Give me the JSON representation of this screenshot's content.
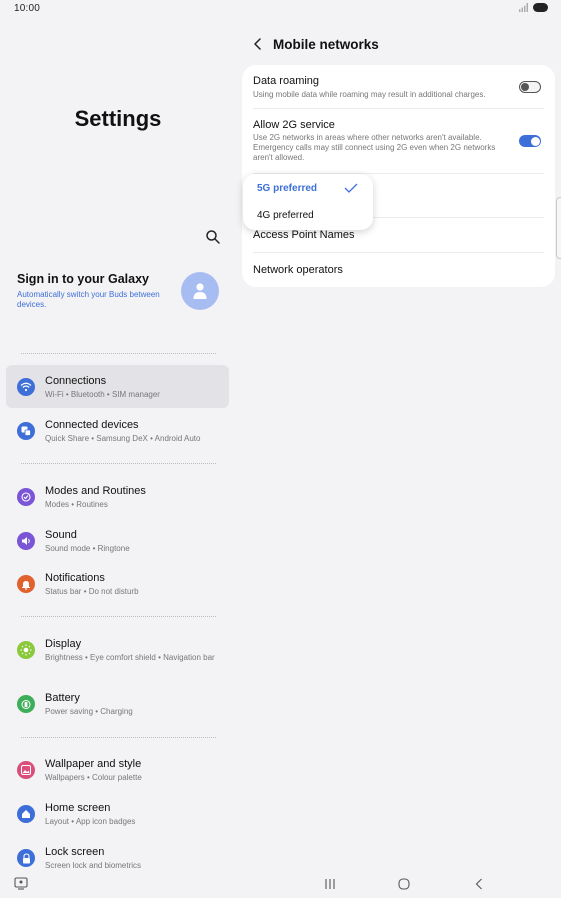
{
  "status_bar": {
    "time": "10:00"
  },
  "left_pane": {
    "title": "Settings",
    "account": {
      "title": "Sign in to your Galaxy",
      "subtitle": "Automatically switch your Buds between devices."
    },
    "items": [
      {
        "title": "Connections",
        "subtitle": "Wi-Fi  •  Bluetooth  •  SIM manager",
        "icon": "wifi-icon",
        "color": "#3e6fd8"
      },
      {
        "title": "Connected devices",
        "subtitle": "Quick Share  •  Samsung DeX  •  Android Auto",
        "icon": "connected-devices-icon",
        "color": "#3e6fd8"
      },
      {
        "title": "Modes and Routines",
        "subtitle": "Modes  •  Routines",
        "icon": "modes-icon",
        "color": "#7a55d6"
      },
      {
        "title": "Sound",
        "subtitle": "Sound mode  •  Ringtone",
        "icon": "sound-icon",
        "color": "#7a55d6"
      },
      {
        "title": "Notifications",
        "subtitle": "Status bar  •  Do not disturb",
        "icon": "bell-icon",
        "color": "#e0622f"
      },
      {
        "title": "Display",
        "subtitle": "Brightness  •  Eye comfort shield  •  Navigation bar",
        "icon": "brightness-icon",
        "color": "#8cc83c"
      },
      {
        "title": "Battery",
        "subtitle": "Power saving  •  Charging",
        "icon": "battery-item-icon",
        "color": "#3fae5a"
      },
      {
        "title": "Wallpaper and style",
        "subtitle": "Wallpapers  •  Colour palette",
        "icon": "wallpaper-icon",
        "color": "#d94f7a"
      },
      {
        "title": "Home screen",
        "subtitle": "Layout  •  App icon badges",
        "icon": "home-icon",
        "color": "#3e6fd8"
      },
      {
        "title": "Lock screen",
        "subtitle": "Screen lock and biometrics",
        "icon": "lock-icon",
        "color": "#3e6fd8"
      }
    ]
  },
  "right_pane": {
    "title": "Mobile networks",
    "data_roaming": {
      "title": "Data roaming",
      "subtitle": "Using mobile data while roaming may result in additional charges.",
      "enabled": false
    },
    "allow_2g": {
      "title": "Allow 2G service",
      "subtitle": "Use 2G networks in areas where other networks aren't available. Emergency calls may still connect using 2G even when 2G networks aren't allowed.",
      "enabled": true
    },
    "access_point_names": "Access Point Names",
    "network_operators": "Network operators",
    "network_mode_options": [
      "5G preferred",
      "4G preferred"
    ],
    "network_mode_selected": "5G preferred"
  },
  "colors": {
    "accent": "#3e6fd8",
    "background": "#f3f3f6",
    "card": "#ffffff"
  }
}
